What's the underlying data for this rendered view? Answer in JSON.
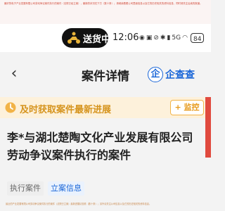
{
  "top_notice": "最好的电子产业发展有限公司劳动争议案件执行的案件（法院已经立案），最新的状况在下方（数十条）；请继续看看公司里面信息以及它的历史相关的资料信息，同时请关注后续的报道。",
  "status_bar": {
    "delivery_label": "送货中",
    "time": "12:06",
    "icons": [
      "eye-icon",
      "nfc-icon",
      "mute-icon",
      "bluetooth-icon",
      "signal-icon",
      "wifi-icon"
    ],
    "signal_label": "5G",
    "battery": "84"
  },
  "nav": {
    "back": "‹",
    "title": "案件详情",
    "brand_logo": "企",
    "brand_name": "企查查"
  },
  "banner": {
    "text": "及时获取案件最新进展",
    "follow": "+ 监控"
  },
  "case": {
    "title": "李*与湖北楚陶文化产业发展有限公司劳动争议案件执行的案件"
  },
  "tags": [
    "执行案件",
    "立案信息"
  ],
  "bottom_notice": "最近的产业发展有限公司劳动争议案件执行的案件（法院已立案）最新进展请查看（数十条）；另外请关注公司信息以及它的历史相关的资料信息。",
  "colors": {
    "accent": "#1a66d8",
    "banner_text": "#d6941e",
    "banner_bg": "#fdf1db",
    "side_strip": "#e04a3e"
  }
}
